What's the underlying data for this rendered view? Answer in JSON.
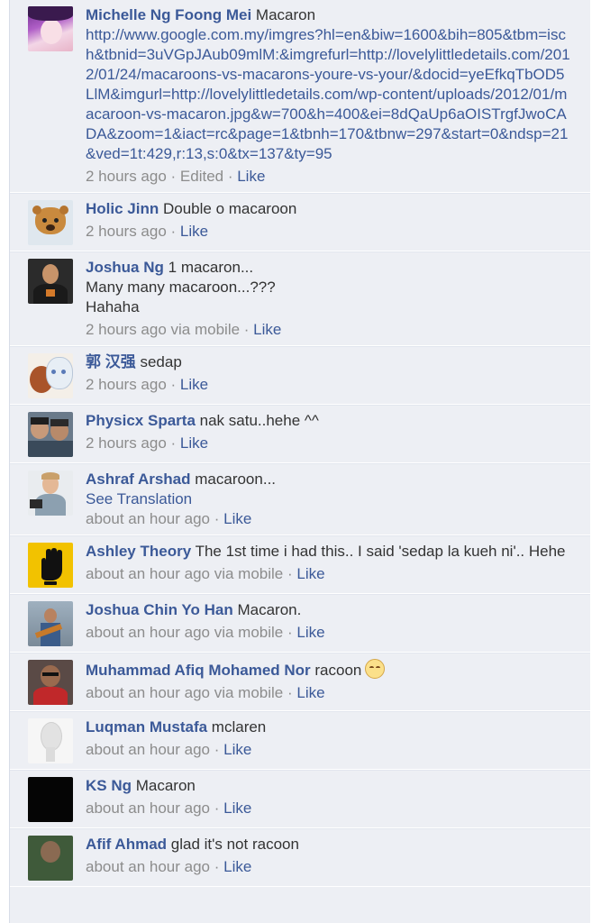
{
  "comments": [
    {
      "author": "Michelle Ng Foong Mei",
      "text": "Macaron",
      "link": "http://www.google.com.my/imgres?hl=en&biw=1600&bih=805&tbm=isch&tbnid=3uVGpJAub09mlM:&imgrefurl=http://lovelylittledetails.com/2012/01/24/macaroons-vs-macarons-youre-vs-your/&docid=yeEfkqTbOD5LlM&imgurl=http://lovelylittledetails.com/wp-content/uploads/2012/01/macaroon-vs-macaron.jpg&w=700&h=400&ei=8dQaUp6aOISTrgfJwoCADA&zoom=1&iact=rc&page=1&tbnh=170&tbnw=297&start=0&ndsp=21&ved=1t:429,r:13,s:0&tx=137&ty=95",
      "time": "2 hours ago",
      "suffix": " · Edited · ",
      "like": "Like"
    },
    {
      "author": "Holic Jinn",
      "text": "Double o macaroon",
      "time": "2 hours ago",
      "suffix": " · ",
      "like": "Like"
    },
    {
      "author": "Joshua Ng",
      "text": "1 macaron...\nMany many macaroon...???\nHahaha",
      "time": "2 hours ago via mobile",
      "suffix": " · ",
      "like": "Like"
    },
    {
      "author": "郭 汉强",
      "text": "sedap",
      "time": "2 hours ago",
      "suffix": " · ",
      "like": "Like"
    },
    {
      "author": "Physicx Sparta",
      "text": "nak satu..hehe ^^",
      "time": "2 hours ago",
      "suffix": " · ",
      "like": "Like"
    },
    {
      "author": "Ashraf Arshad",
      "text": "macaroon...",
      "translation": "See Translation",
      "time": "about an hour ago",
      "suffix": " · ",
      "like": "Like"
    },
    {
      "author": "Ashley Theory",
      "text": "The 1st time i had this.. I said 'sedap la kueh ni'.. Hehe",
      "time": "about an hour ago via mobile",
      "suffix": " · ",
      "like": "Like"
    },
    {
      "author": "Joshua Chin Yo Han",
      "text": "Macaron.",
      "time": "about an hour ago via mobile",
      "suffix": " · ",
      "like": "Like"
    },
    {
      "author": "Muhammad Afiq Mohamed Nor",
      "text": "racoon",
      "time": "about an hour ago via mobile",
      "suffix": " · ",
      "like": "Like"
    },
    {
      "author": "Luqman Mustafa",
      "text": "mclaren",
      "time": "about an hour ago",
      "suffix": " · ",
      "like": "Like"
    },
    {
      "author": "KS Ng",
      "text": "Macaron",
      "time": "about an hour ago",
      "suffix": " · ",
      "like": "Like"
    },
    {
      "author": "Afif Ahmad",
      "text": "glad it's not racoon",
      "time": "about an hour ago",
      "suffix": " · ",
      "like": "Like"
    }
  ],
  "colors": {
    "link": "#3b5998",
    "meta": "#8c8c8c",
    "background": "#edeff4"
  }
}
